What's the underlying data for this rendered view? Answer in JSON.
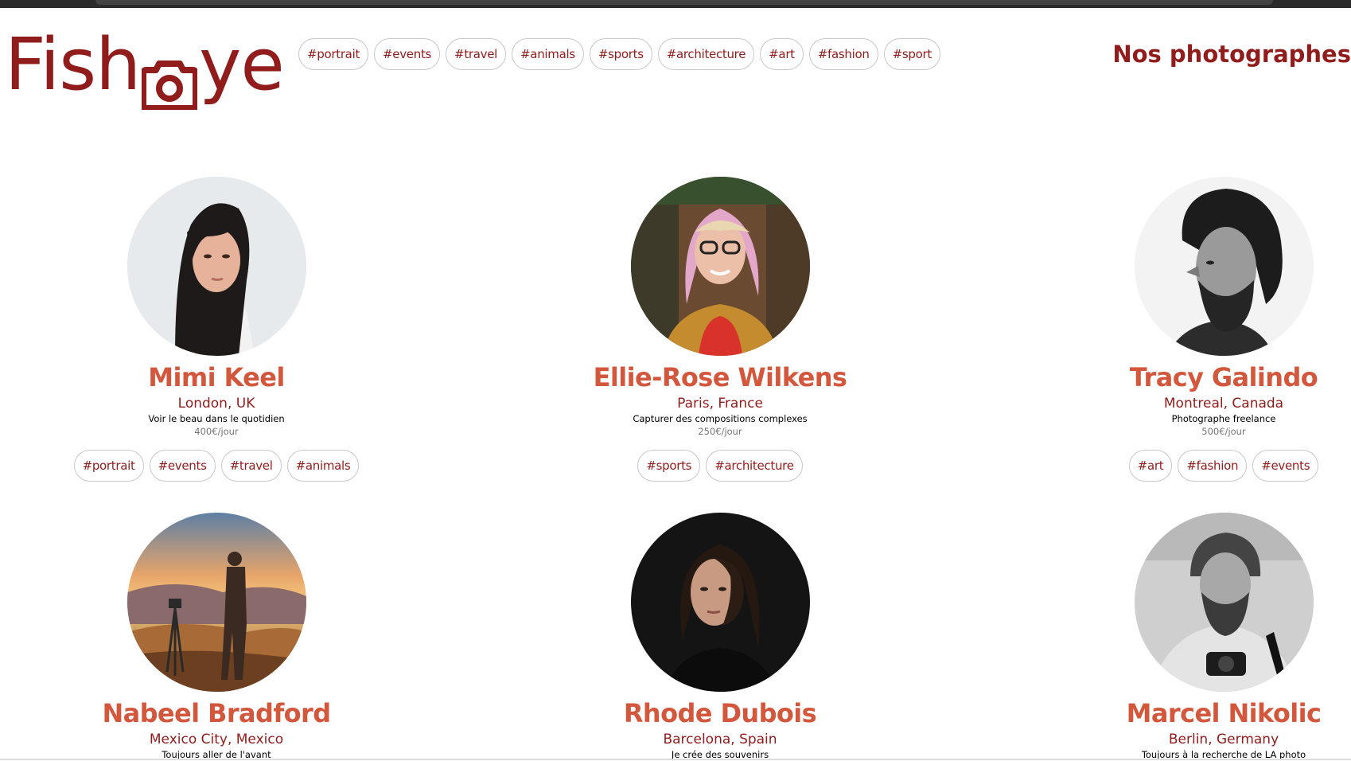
{
  "logo": {
    "text_before": "Fish",
    "text_after": "ye"
  },
  "nav_tags": [
    "#portrait",
    "#events",
    "#travel",
    "#animals",
    "#sports",
    "#architecture",
    "#art",
    "#fashion",
    "#sport"
  ],
  "page_title": "Nos photographes",
  "photographers": [
    {
      "name": "Mimi Keel",
      "location": "London, UK",
      "tagline": "Voir le beau dans le quotidien",
      "price": "400€/jour",
      "tags": [
        "#portrait",
        "#events",
        "#travel",
        "#animals"
      ]
    },
    {
      "name": "Ellie-Rose Wilkens",
      "location": "Paris, France",
      "tagline": "Capturer des compositions complexes",
      "price": "250€/jour",
      "tags": [
        "#sports",
        "#architecture"
      ]
    },
    {
      "name": "Tracy Galindo",
      "location": "Montreal, Canada",
      "tagline": "Photographe freelance",
      "price": "500€/jour",
      "tags": [
        "#art",
        "#fashion",
        "#events"
      ]
    },
    {
      "name": "Nabeel Bradford",
      "location": "Mexico City, Mexico",
      "tagline": "Toujours aller de l'avant",
      "price": "",
      "tags": []
    },
    {
      "name": "Rhode Dubois",
      "location": "Barcelona, Spain",
      "tagline": "Je crée des souvenirs",
      "price": "",
      "tags": []
    },
    {
      "name": "Marcel Nikolic",
      "location": "Berlin, Germany",
      "tagline": "Toujours à la recherche de LA photo",
      "price": "",
      "tags": []
    }
  ],
  "colors": {
    "brand": "#901c1c",
    "name": "#d3573c",
    "price": "#757575"
  }
}
